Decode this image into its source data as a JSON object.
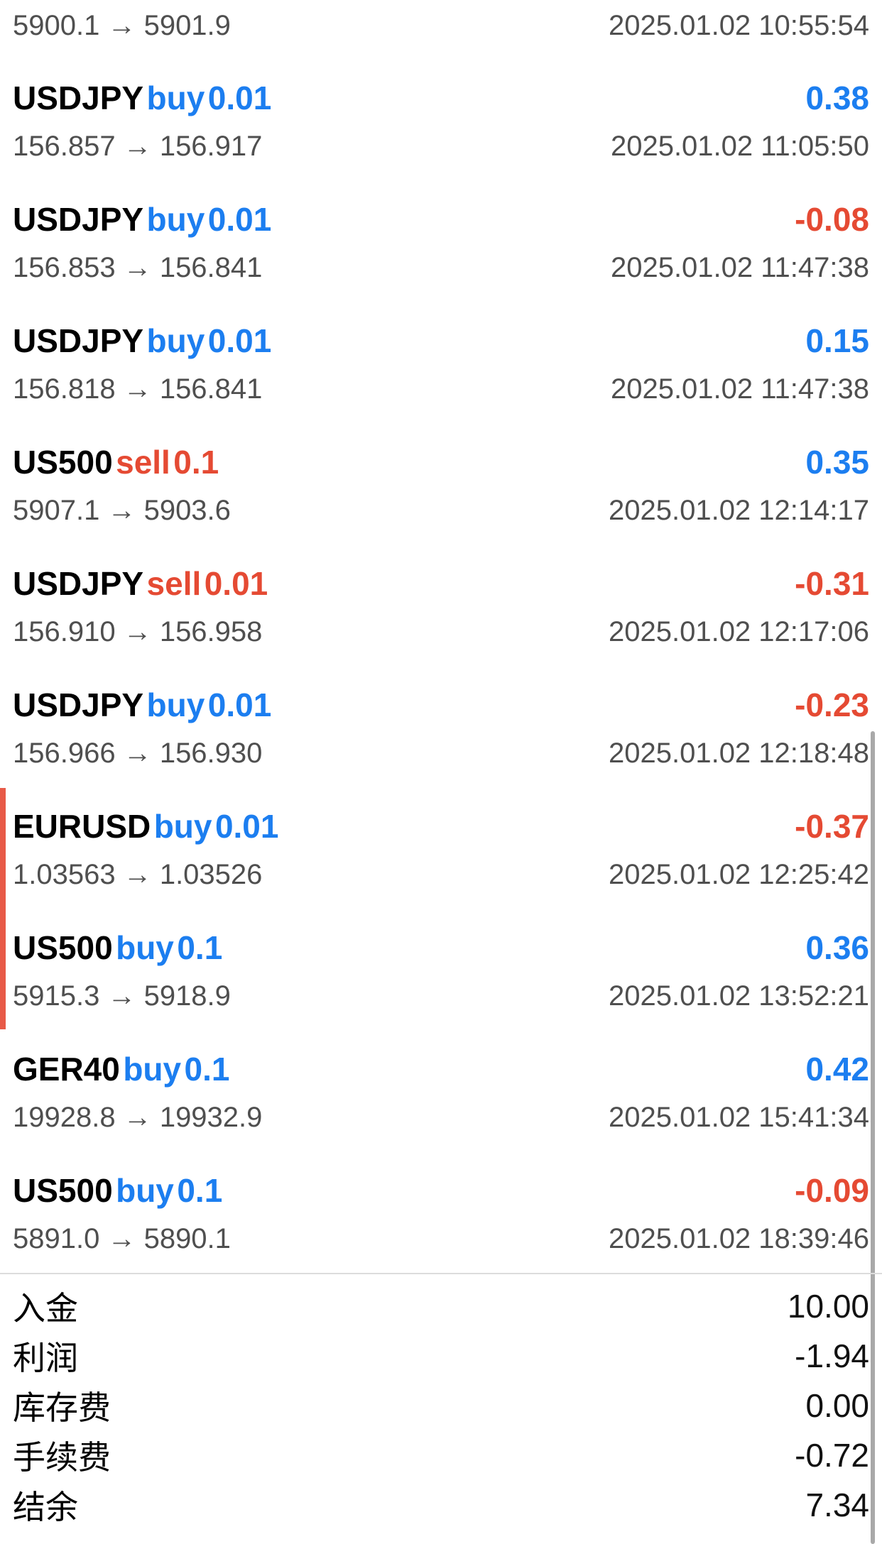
{
  "top_partial": {
    "prices": "5900.1 → 5901.9",
    "time": "2025.01.02 10:55:54"
  },
  "trades": [
    {
      "symbol": "USDJPY",
      "direction": "buy",
      "volume": "0.01",
      "profit": "0.38",
      "prices": "156.857 → 156.917",
      "time": "2025.01.02 11:05:50"
    },
    {
      "symbol": "USDJPY",
      "direction": "buy",
      "volume": "0.01",
      "profit": "-0.08",
      "prices": "156.853 → 156.841",
      "time": "2025.01.02 11:47:38"
    },
    {
      "symbol": "USDJPY",
      "direction": "buy",
      "volume": "0.01",
      "profit": "0.15",
      "prices": "156.818 → 156.841",
      "time": "2025.01.02 11:47:38"
    },
    {
      "symbol": "US500",
      "direction": "sell",
      "volume": "0.1",
      "profit": "0.35",
      "prices": "5907.1 → 5903.6",
      "time": "2025.01.02 12:14:17"
    },
    {
      "symbol": "USDJPY",
      "direction": "sell",
      "volume": "0.01",
      "profit": "-0.31",
      "prices": "156.910 → 156.958",
      "time": "2025.01.02 12:17:06"
    },
    {
      "symbol": "USDJPY",
      "direction": "buy",
      "volume": "0.01",
      "profit": "-0.23",
      "prices": "156.966 → 156.930",
      "time": "2025.01.02 12:18:48"
    },
    {
      "symbol": "EURUSD",
      "direction": "buy",
      "volume": "0.01",
      "profit": "-0.37",
      "prices": "1.03563 → 1.03526",
      "time": "2025.01.02 12:25:42"
    },
    {
      "symbol": "US500",
      "direction": "buy",
      "volume": "0.1",
      "profit": "0.36",
      "prices": "5915.3 → 5918.9",
      "time": "2025.01.02 13:52:21"
    },
    {
      "symbol": "GER40",
      "direction": "buy",
      "volume": "0.1",
      "profit": "0.42",
      "prices": "19928.8 → 19932.9",
      "time": "2025.01.02 15:41:34"
    },
    {
      "symbol": "US500",
      "direction": "buy",
      "volume": "0.1",
      "profit": "-0.09",
      "prices": "5891.0 → 5890.1",
      "time": "2025.01.02 18:39:46"
    }
  ],
  "summary": [
    {
      "label": "入金",
      "value": "10.00"
    },
    {
      "label": "利润",
      "value": "-1.94"
    },
    {
      "label": "库存费",
      "value": "0.00"
    },
    {
      "label": "手续费",
      "value": "-0.72"
    },
    {
      "label": "结余",
      "value": "7.34"
    }
  ],
  "colors": {
    "buy": "#1c7ef0",
    "sell": "#e54a33",
    "positive": "#1c7ef0",
    "negative": "#e54a33",
    "marker": "#e85a47"
  }
}
